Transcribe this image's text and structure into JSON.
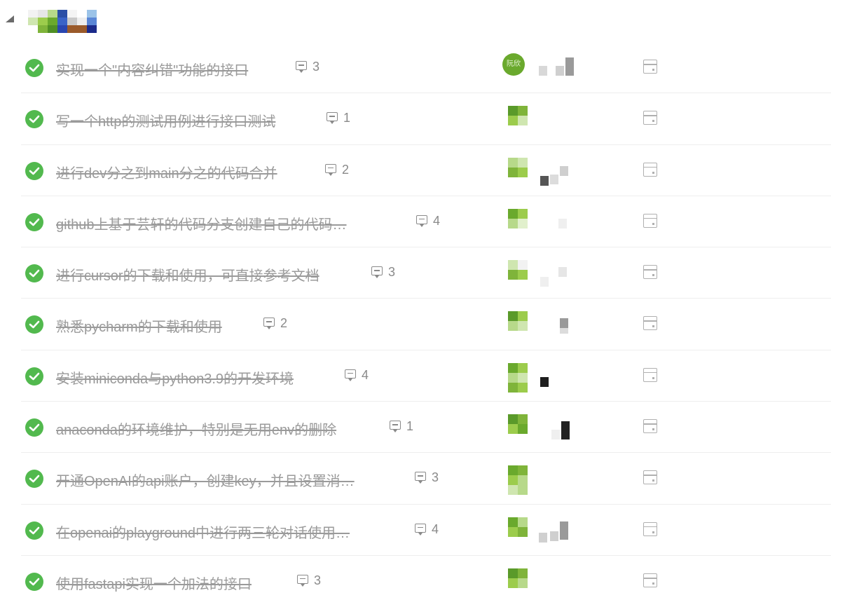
{
  "colors": {
    "check": "#52b94e",
    "text_done": "#9a9a9a",
    "divider": "#eeeeee",
    "avatar_green": "#8cc63f"
  },
  "tasks": [
    {
      "title": "实现一个\"内容纠错\"功能的接口",
      "comments": "3",
      "avatar_label": "阮欣"
    },
    {
      "title": "写一个http的测试用例进行接口测试",
      "comments": "1"
    },
    {
      "title": "进行dev分之到main分之的代码合并",
      "comments": "2"
    },
    {
      "title": "github上基于芸轩的代码分支创建自己的代码…",
      "comments": "4"
    },
    {
      "title": "进行cursor的下载和使用，可直接参考文档",
      "comments": "3"
    },
    {
      "title": "熟悉pycharm的下载和使用",
      "comments": "2"
    },
    {
      "title": "安装miniconda与python3.9的开发环境",
      "comments": "4"
    },
    {
      "title": "anaconda的环境维护，特别是无用env的删除",
      "comments": "1"
    },
    {
      "title": "开通OpenAI的api账户，创建key，并且设置消…",
      "comments": "3"
    },
    {
      "title": "在openai的playground中进行两三轮对话使用…",
      "comments": "4"
    },
    {
      "title": "使用fastapi实现一个加法的接口",
      "comments": "3"
    }
  ]
}
